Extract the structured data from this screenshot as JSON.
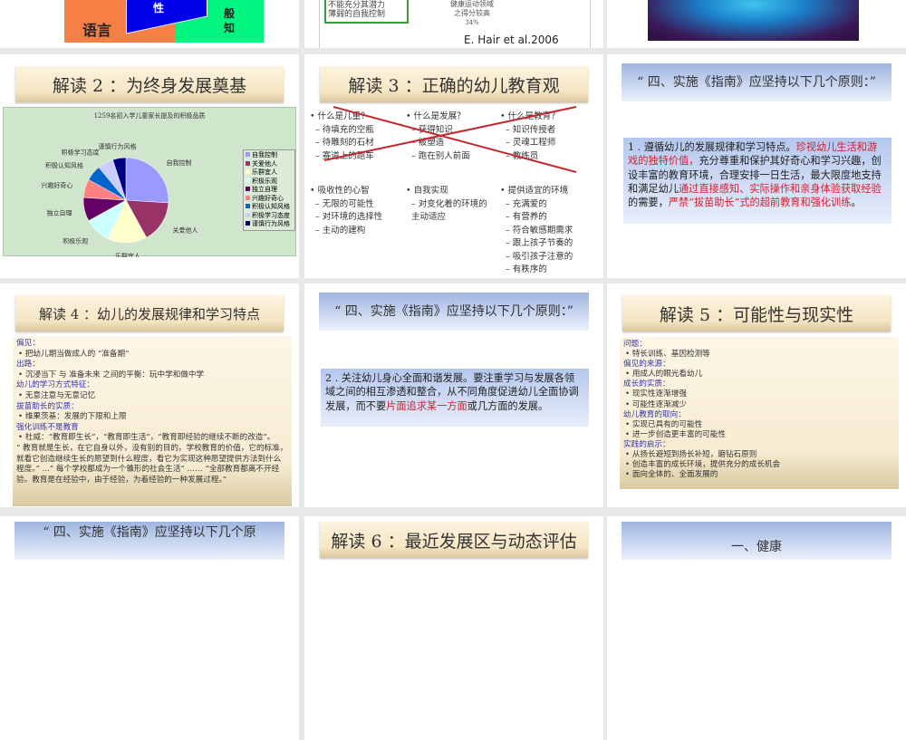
{
  "slides": {
    "top1": {
      "words": [
        "语言",
        "性",
        "般",
        "知"
      ]
    },
    "top2": {
      "box_lines": [
        "不能充分其潜力",
        "薄弱的自我控制"
      ],
      "mid_lines": [
        "健康运动领域",
        "之得分较高",
        "34%"
      ],
      "citation": "E. Hair et al.2006"
    },
    "s2": {
      "title": "解读 2 ：为终身发展奠基"
    },
    "s3": {
      "title": "解读 3 ：正确的幼儿教育观",
      "crossed": [
        {
          "q": "什么是儿童？",
          "items": [
            "待填充的空瓶",
            "待雕刻的石材",
            "赛道上的跑车"
          ]
        },
        {
          "q": "什么是发展？",
          "items": [
            "获得知识",
            "被塑造",
            "跑在别人前面"
          ]
        },
        {
          "q": "什么是教育？",
          "items": [
            "知识传授者",
            "灵魂工程师",
            "教练员"
          ]
        }
      ],
      "right": [
        {
          "q": "吸收性的心智",
          "items": [
            "无限的可能性",
            "对环境的选择性",
            "主动的建构"
          ]
        },
        {
          "q": "自我实现",
          "items": [
            "对变化着的环境的主动适应"
          ]
        },
        {
          "q": "提供适宜的环境",
          "items": [
            "充满爱的",
            "有营养的",
            "符合敏感期需求",
            "跟上孩子节奏的",
            "吸引孩子注意的",
            "有秩序的"
          ]
        }
      ]
    },
    "s4": {
      "title": "“ 四、实施《指南》应坚持以下几个原则：”",
      "p1": "1 . 遵循幼儿的发展规律和学习特点。",
      "p2": "珍视幼儿生活和游戏的独特价值，",
      "p3": "充分尊重和保护其好奇心和学习兴趣，创设丰富的教育环境，合理安排一日生活，最大限度地支持和满足幼儿",
      "p4": "通过直接感知、实际操作和亲身体验获取经验",
      "p5": "的需要，",
      "p6": "严禁“拔苗助长”式的超前教育和强化训练",
      "p7": "。"
    },
    "s5": {
      "title": "解读 4 ：幼儿的发展规律和学习特点",
      "lines": [
        {
          "t": "h",
          "v": "偏见："
        },
        {
          "t": "b",
          "v": "把幼儿期当做成人的 “准备期”"
        },
        {
          "t": "h",
          "v": "出路："
        },
        {
          "t": "b",
          "v": "沉浸当下 与 准备未来 之间的平衡：玩中学和做中学"
        },
        {
          "t": "h",
          "v": "幼儿的学习方式特征："
        },
        {
          "t": "b",
          "v": "无意注意与无意记忆"
        },
        {
          "t": "h",
          "v": "拔苗助长的实质："
        },
        {
          "t": "b",
          "v": "维果茨基：发展的下限和上限"
        },
        {
          "t": "h",
          "v": "强化训练不是教育"
        },
        {
          "t": "b",
          "v": "杜威：“教育即生长”，“教育即生活”，“教育即经验的继续不断的改造”。"
        },
        {
          "t": "p",
          "v": "“ 教育就是生长，在它自身以外，没有别的目的。学校教育的价值，它的标准，就看它创造继续生长的愿望到什么程度，看它为实现这种愿望提供方法到什么程度。” ...“ 每个学校都成为一个雏形的社会生活” …… “全部教育都离不开经验。教育是在经验中，由于经验，为着经验的一种发展过程。”"
        }
      ]
    },
    "s6": {
      "title": "“ 四、实施《指南》应坚持以下几个原则：”",
      "p1": "2 . 关注幼儿身心全面和谐发展。要注重学习与发展各领域之间的相互渗透和整合，从不同角度促进幼儿全面协调发展，而不要",
      "p2": "片面追求某一方面",
      "p3": "或几方面的发展。"
    },
    "s7": {
      "title": "解读 5 ：可能性与现实性",
      "lines": [
        {
          "t": "h",
          "v": "问题："
        },
        {
          "t": "b",
          "v": "特长训练、基因检测等"
        },
        {
          "t": "h",
          "v": "偏见的来源："
        },
        {
          "t": "b",
          "v": "用成人的眼光看幼儿"
        },
        {
          "t": "h",
          "v": "成长的实质："
        },
        {
          "t": "b",
          "v": "现实性逐渐增强"
        },
        {
          "t": "b",
          "v": "可能性逐渐减少"
        },
        {
          "t": "h",
          "v": "幼儿教育的取向："
        },
        {
          "t": "b",
          "v": "实现已具有的可能性"
        },
        {
          "t": "b",
          "v": "进一步创造更丰富的可能性"
        },
        {
          "t": "h",
          "v": "实践的启示："
        },
        {
          "t": "b",
          "v": "从扬长避短到扬长补短，磨钻石原则"
        },
        {
          "t": "b",
          "v": "创造丰富的成长环境，提供充分的成长机会"
        },
        {
          "t": "b",
          "v": "面向全体的、全面发展的"
        }
      ]
    },
    "s8": {
      "title": "“ 四、实施《指南》应坚持以下几个原"
    },
    "s9": {
      "title": "解读 6 ：最近发展区与动态评估"
    },
    "s10": {
      "title": "一、健康"
    }
  },
  "chart_data": {
    "type": "pie",
    "title": "1259名初入学儿童家长提及的积极品质",
    "categories": [
      "自我控制",
      "关爱他人",
      "乐群宜人",
      "积极乐观",
      "独立自理",
      "兴趣好奇心",
      "积极认知风格",
      "积极学习态度",
      "谨慎行为风格"
    ],
    "values": [
      26,
      16,
      15,
      10,
      9,
      7,
      6,
      6,
      5
    ],
    "colors": [
      "#9999ff",
      "#993366",
      "#ffffcc",
      "#ccffff",
      "#660066",
      "#ff8080",
      "#0066cc",
      "#ccccff",
      "#000080"
    ],
    "legend": "right"
  }
}
